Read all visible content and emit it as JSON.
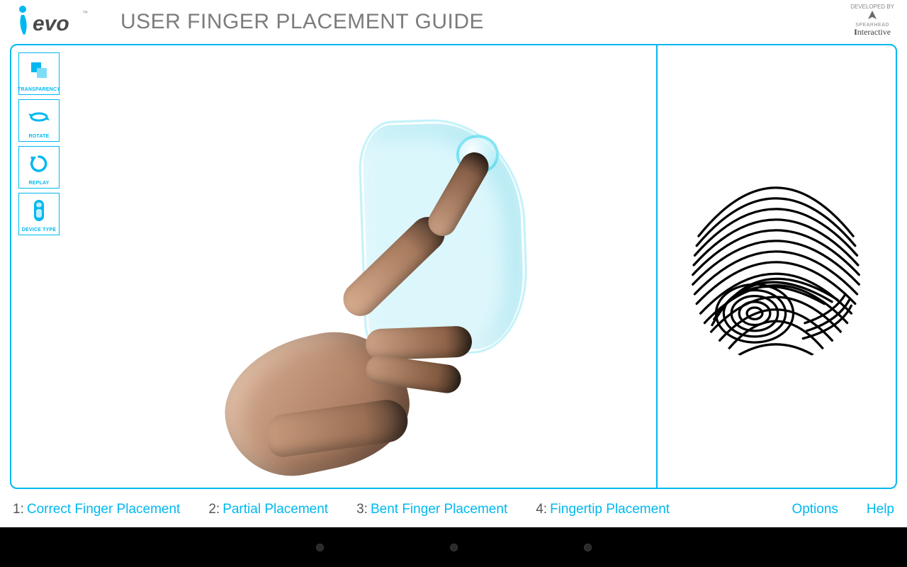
{
  "header": {
    "title": "USER FINGER PLACEMENT GUIDE",
    "logo_text_main": "evo",
    "logo_tm": "™",
    "developed_by_label": "DEVELOPED BY",
    "developer_name_1": "SPEARHEAD",
    "developer_name_2": "Interactive"
  },
  "toolbar": [
    {
      "id": "transparency",
      "label": "TRANSPARENCY",
      "icon": "transparency-icon"
    },
    {
      "id": "rotate",
      "label": "ROTATE",
      "icon": "rotate-icon"
    },
    {
      "id": "replay",
      "label": "REPLAY",
      "icon": "replay-icon"
    },
    {
      "id": "devicetype",
      "label": "DEVICE TYPE",
      "icon": "device-type-icon"
    }
  ],
  "nav": [
    {
      "num": "1:",
      "label": "Correct Finger Placement"
    },
    {
      "num": "2:",
      "label": "Partial Placement"
    },
    {
      "num": "3:",
      "label": "Bent Finger Placement"
    },
    {
      "num": "4:",
      "label": "Fingertip Placement"
    }
  ],
  "menu": {
    "options": "Options",
    "help": "Help"
  },
  "colors": {
    "accent": "#00b8f0"
  }
}
